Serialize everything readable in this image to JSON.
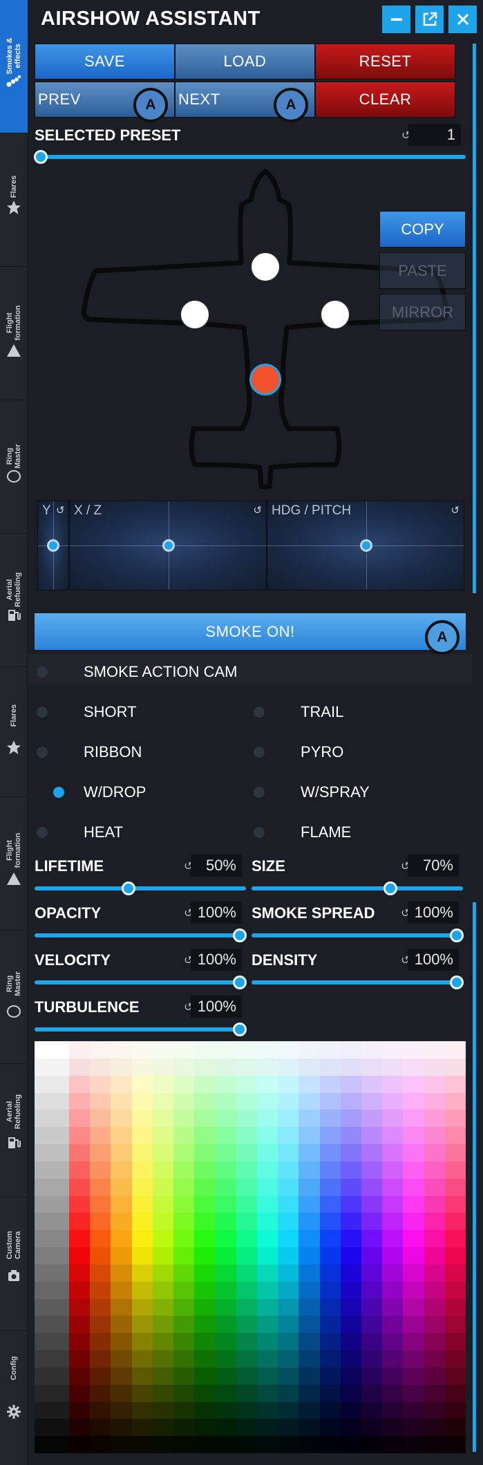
{
  "app": {
    "title": "AIRSHOW ASSISTANT"
  },
  "window_controls": {
    "minimize_icon": "minimize-icon",
    "popout_icon": "popout-icon",
    "close_icon": "close-icon"
  },
  "sidebar": {
    "tabs_top": [
      {
        "label": "Smokes &\neffects",
        "icon": "smoke-icon",
        "active": true
      },
      {
        "label": "Flares",
        "icon": "star-icon"
      },
      {
        "label": "Flight\nformation",
        "icon": "triangle-icon"
      },
      {
        "label": "Ring\nMaster",
        "icon": "ring-icon"
      },
      {
        "label": "Aerial\nRefueling",
        "icon": "fuel-icon"
      }
    ],
    "tabs_bottom": [
      {
        "label": "Flares",
        "icon": "star-icon"
      },
      {
        "label": "Flight\nformation",
        "icon": "triangle-icon"
      },
      {
        "label": "Ring\nMaster",
        "icon": "ring-icon"
      },
      {
        "label": "Aerial\nRefueling",
        "icon": "fuel-icon"
      },
      {
        "label": "Custom\nCamera",
        "icon": "camera-icon"
      },
      {
        "label": "Config",
        "icon": "gear-icon"
      }
    ]
  },
  "toolbar": {
    "save": "SAVE",
    "load": "LOAD",
    "reset": "RESET",
    "prev": "PREV",
    "next": "NEXT",
    "clear": "CLEAR",
    "badge": "A"
  },
  "preset": {
    "label": "SELECTED PRESET",
    "value": "1",
    "reset_glyph": "↺"
  },
  "plane": {
    "actions": {
      "copy": "COPY",
      "paste": "PASTE",
      "mirror": "MIRROR"
    }
  },
  "pads": {
    "y": "Y",
    "xz": "X / Z",
    "hdg_pitch": "HDG / PITCH",
    "reset_glyph": "↺"
  },
  "smoke": {
    "button": "SMOKE ON!",
    "badge": "A"
  },
  "options": {
    "action_cam": "SMOKE ACTION CAM",
    "types": [
      {
        "label": "SHORT",
        "selected": false
      },
      {
        "label": "TRAIL",
        "selected": false
      },
      {
        "label": "RIBBON",
        "selected": false
      },
      {
        "label": "PYRO",
        "selected": false
      },
      {
        "label": "W/DROP",
        "selected": true
      },
      {
        "label": "W/SPRAY",
        "selected": false
      },
      {
        "label": "HEAT",
        "selected": false
      },
      {
        "label": "FLAME",
        "selected": false
      }
    ]
  },
  "params": {
    "lifetime": {
      "label": "LIFETIME",
      "value": "50%"
    },
    "size": {
      "label": "SIZE",
      "value": "70%"
    },
    "opacity": {
      "label": "OPACITY",
      "value": "100%"
    },
    "smoke_spread": {
      "label": "SMOKE SPREAD",
      "value": "100%"
    },
    "velocity": {
      "label": "VELOCITY",
      "value": "100%"
    },
    "density": {
      "label": "DENSITY",
      "value": "100%"
    },
    "turbulence": {
      "label": "TURBULENCE",
      "value": "100%"
    },
    "reset_glyph": "↺"
  },
  "colors": {
    "accent": "#1ea4e8",
    "button_blue": "#2b7fd9",
    "button_red": "#a31212",
    "background": "#1b1e24"
  }
}
